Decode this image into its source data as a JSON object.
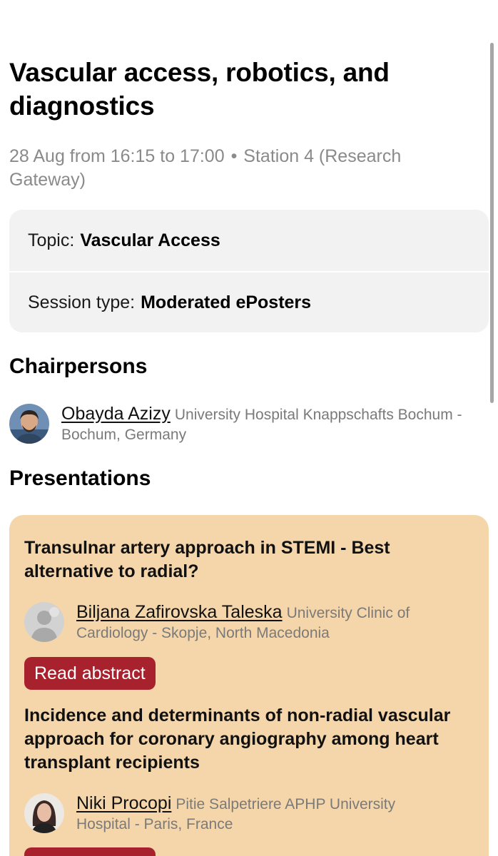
{
  "session": {
    "title": "Vascular access, robotics, and diagnostics",
    "date_time": "28 Aug from 16:15 to 17:00",
    "separator": "•",
    "location": "Station 4 (Research Gateway)"
  },
  "info": {
    "topic_label": "Topic:",
    "topic_value": "Vascular Access",
    "type_label": "Session type:",
    "type_value": "Moderated ePosters"
  },
  "chairpersons": {
    "heading": "Chairpersons",
    "items": [
      {
        "name": "Obayda Azizy",
        "affiliation": "University Hospital Knappschafts Bochum - Bochum, Germany"
      }
    ]
  },
  "presentations": {
    "heading": "Presentations",
    "items": [
      {
        "title": "Transulnar artery approach in STEMI - Best alternative to radial?",
        "author": "Biljana Zafirovska Taleska",
        "affiliation": "University Clinic of Cardiology - Skopje, North Macedonia",
        "button": "Read abstract"
      },
      {
        "title": "Incidence and determinants of non-radial vascular approach for coronary angiography among heart transplant recipients",
        "author": "Niki Procopi",
        "affiliation": "Pitie Salpetriere APHP University Hospital - Paris, France",
        "button": "Read abstract"
      }
    ]
  },
  "colors": {
    "card_background": "#f5d6aa",
    "button_background": "#a8222e",
    "info_background": "#f2f2f2",
    "meta_text": "#8a8a8a"
  }
}
